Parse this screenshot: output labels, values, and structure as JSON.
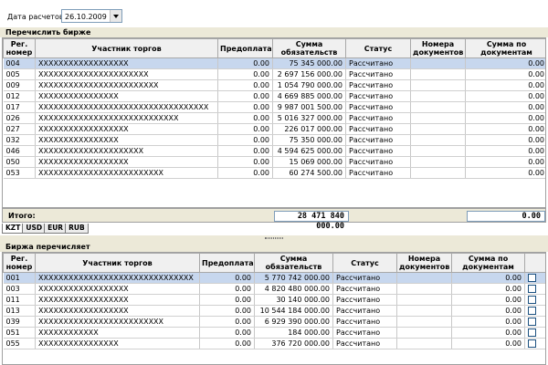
{
  "toolbar": {
    "date_label": "Дата расчетов",
    "date_value": "26.10.2009"
  },
  "top_panel": {
    "title": "Перечислить бирже",
    "columns": [
      "Рег. номер",
      "Участник торгов",
      "Предоплата",
      "Сумма обязательств",
      "Статус",
      "Номера документов",
      "Сумма по документам"
    ],
    "rows": [
      {
        "reg": "004",
        "name": "XXXXXXXXXXXXXXXXXX",
        "prepay": "0.00",
        "sum": "75 345 000.00",
        "status": "Рассчитано",
        "docs": "",
        "docsum": "0.00"
      },
      {
        "reg": "005",
        "name": "XXXXXXXXXXXXXXXXXXXXXX",
        "prepay": "0.00",
        "sum": "2 697 156 000.00",
        "status": "Рассчитано",
        "docs": "",
        "docsum": "0.00"
      },
      {
        "reg": "009",
        "name": "XXXXXXXXXXXXXXXXXXXXXXXX",
        "prepay": "0.00",
        "sum": "1 054 790 000.00",
        "status": "Рассчитано",
        "docs": "",
        "docsum": "0.00"
      },
      {
        "reg": "012",
        "name": "XXXXXXXXXXXXXXXX",
        "prepay": "0.00",
        "sum": "4 669 885 000.00",
        "status": "Рассчитано",
        "docs": "",
        "docsum": "0.00"
      },
      {
        "reg": "017",
        "name": "XXXXXXXXXXXXXXXXXXXXXXXXXXXXXXXXXX",
        "prepay": "0.00",
        "sum": "9 987 001 500.00",
        "status": "Рассчитано",
        "docs": "",
        "docsum": "0.00"
      },
      {
        "reg": "026",
        "name": "XXXXXXXXXXXXXXXXXXXXXXXXXXXX",
        "prepay": "0.00",
        "sum": "5 016 327 000.00",
        "status": "Рассчитано",
        "docs": "",
        "docsum": "0.00"
      },
      {
        "reg": "027",
        "name": "XXXXXXXXXXXXXXXXXX",
        "prepay": "0.00",
        "sum": "226 017 000.00",
        "status": "Рассчитано",
        "docs": "",
        "docsum": "0.00"
      },
      {
        "reg": "032",
        "name": "XXXXXXXXXXXXXXXX",
        "prepay": "0.00",
        "sum": "75 350 000.00",
        "status": "Рассчитано",
        "docs": "",
        "docsum": "0.00"
      },
      {
        "reg": "046",
        "name": "XXXXXXXXXXXXXXXXXXXXX",
        "prepay": "0.00",
        "sum": "4 594 625 000.00",
        "status": "Рассчитано",
        "docs": "",
        "docsum": "0.00"
      },
      {
        "reg": "050",
        "name": "XXXXXXXXXXXXXXXXXX",
        "prepay": "0.00",
        "sum": "15 069 000.00",
        "status": "Рассчитано",
        "docs": "",
        "docsum": "0.00"
      },
      {
        "reg": "053",
        "name": "XXXXXXXXXXXXXXXXXXXXXXXXX",
        "prepay": "0.00",
        "sum": "60 274 500.00",
        "status": "Рассчитано",
        "docs": "",
        "docsum": "0.00"
      }
    ],
    "total_label": "Итого:",
    "total_sum": "28 471 840 000.00",
    "total_docsum": "0.00",
    "tabs": [
      "KZT",
      "USD",
      "EUR",
      "RUB"
    ]
  },
  "bottom_panel": {
    "title": "Биржа перечисляет",
    "columns": [
      "Рег. номер",
      "Участник торгов",
      "Предоплата",
      "Сумма обязательств",
      "Статус",
      "Номера документов",
      "Сумма по документам"
    ],
    "rows": [
      {
        "reg": "001",
        "name": "XXXXXXXXXXXXXXXXXXXXXXXXXXXXXXX",
        "prepay": "0.00",
        "sum": "5 770 742 000.00",
        "status": "Рассчитано",
        "docs": "",
        "docsum": "0.00"
      },
      {
        "reg": "003",
        "name": "XXXXXXXXXXXXXXXXXX",
        "prepay": "0.00",
        "sum": "4 820 480 000.00",
        "status": "Рассчитано",
        "docs": "",
        "docsum": "0.00"
      },
      {
        "reg": "011",
        "name": "XXXXXXXXXXXXXXXXXX",
        "prepay": "0.00",
        "sum": "30 140 000.00",
        "status": "Рассчитано",
        "docs": "",
        "docsum": "0.00"
      },
      {
        "reg": "013",
        "name": "XXXXXXXXXXXXXXXXXX",
        "prepay": "0.00",
        "sum": "10 544 184 000.00",
        "status": "Рассчитано",
        "docs": "",
        "docsum": "0.00"
      },
      {
        "reg": "039",
        "name": "XXXXXXXXXXXXXXXXXXXXXXXXX",
        "prepay": "0.00",
        "sum": "6 929 390 000.00",
        "status": "Рассчитано",
        "docs": "",
        "docsum": "0.00"
      },
      {
        "reg": "051",
        "name": "XXXXXXXXXXXX",
        "prepay": "0.00",
        "sum": "184 000.00",
        "status": "Рассчитано",
        "docs": "",
        "docsum": "0.00"
      },
      {
        "reg": "055",
        "name": "XXXXXXXXXXXXXXXX",
        "prepay": "0.00",
        "sum": "376 720 000.00",
        "status": "Рассчитано",
        "docs": "",
        "docsum": "0.00"
      }
    ]
  },
  "colors": {
    "selected_row": "#c7d7ee",
    "panel_bg": "#ece9d8",
    "header_bg": "#f0f0f0"
  }
}
